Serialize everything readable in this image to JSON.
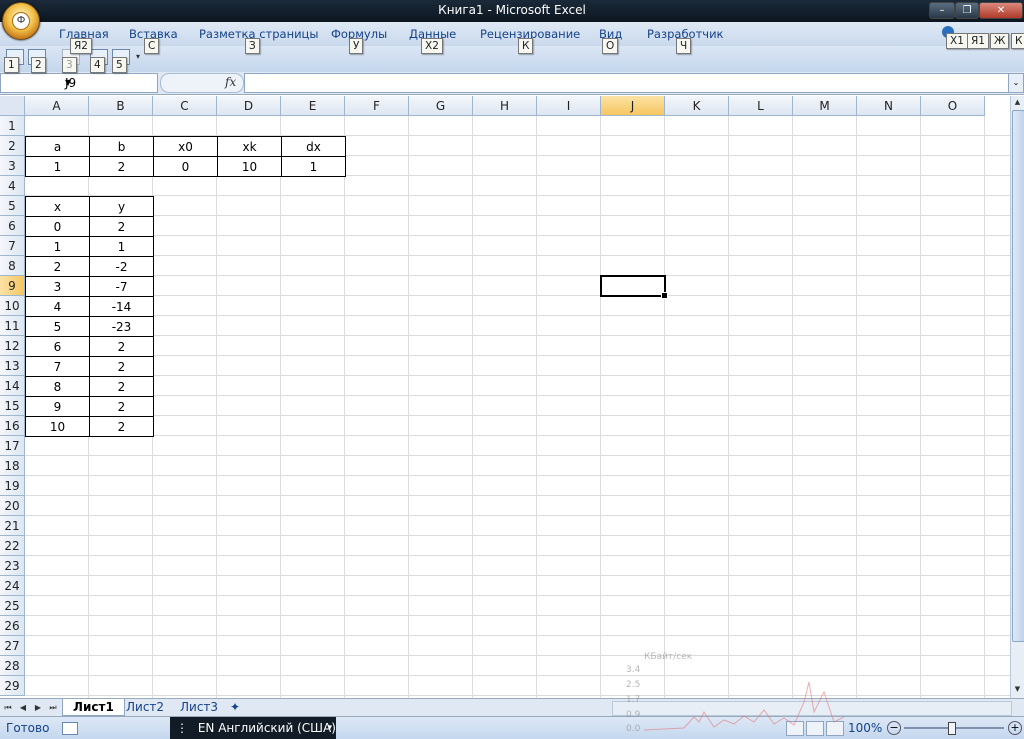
{
  "window": {
    "title": "Книга1 - Microsoft Excel",
    "controls": {
      "minimize": "–",
      "restore": "❐",
      "close": "✕"
    }
  },
  "office_button": {
    "keytip": "Ф"
  },
  "ribbon_tabs": [
    {
      "label": "Главная",
      "keytip": "Я2"
    },
    {
      "label": "Вставка",
      "keytip": "С"
    },
    {
      "label": "Разметка страницы",
      "keytip": "З"
    },
    {
      "label": "Формулы",
      "keytip": "У"
    },
    {
      "label": "Данные",
      "keytip": "Х2"
    },
    {
      "label": "Рецензирование",
      "keytip": "К"
    },
    {
      "label": "Вид",
      "keytip": "О"
    },
    {
      "label": "Разработчик",
      "keytip": "Ч"
    }
  ],
  "right_keytips": [
    "Х1",
    "Я1",
    "Ж",
    "К"
  ],
  "qat_keytips": [
    "1",
    "2",
    "3",
    "4",
    "5"
  ],
  "formula_bar": {
    "name_box": "J9",
    "fx_label": "fx",
    "formula": ""
  },
  "columns": [
    "A",
    "B",
    "C",
    "D",
    "E",
    "F",
    "G",
    "H",
    "I",
    "J",
    "K",
    "L",
    "M",
    "N",
    "O"
  ],
  "rows": [
    "1",
    "2",
    "3",
    "4",
    "5",
    "6",
    "7",
    "8",
    "9",
    "10",
    "11",
    "12",
    "13",
    "14",
    "15",
    "16",
    "17",
    "18",
    "19",
    "20",
    "21",
    "22",
    "23",
    "24",
    "25",
    "26",
    "27",
    "28",
    "29"
  ],
  "selected_cell": {
    "column": "J",
    "row": "9"
  },
  "params_table": {
    "headers": [
      "a",
      "b",
      "x0",
      "xk",
      "dx"
    ],
    "values": [
      "1",
      "2",
      "0",
      "10",
      "1"
    ]
  },
  "xy_table": {
    "headers": [
      "x",
      "y"
    ],
    "rows": [
      [
        "0",
        "2"
      ],
      [
        "1",
        "1"
      ],
      [
        "2",
        "-2"
      ],
      [
        "3",
        "-7"
      ],
      [
        "4",
        "-14"
      ],
      [
        "5",
        "-23"
      ],
      [
        "6",
        "2"
      ],
      [
        "7",
        "2"
      ],
      [
        "8",
        "2"
      ],
      [
        "9",
        "2"
      ],
      [
        "10",
        "2"
      ]
    ]
  },
  "sheet_tabs": [
    {
      "label": "Лист1",
      "active": true
    },
    {
      "label": "Лист2",
      "active": false
    },
    {
      "label": "Лист3",
      "active": false
    }
  ],
  "status": {
    "ready": "Готово",
    "language": "EN Английский (США)",
    "zoom": "100%"
  },
  "network_overlay": {
    "unit": "КБайт/сек",
    "ticks": [
      "3.4",
      "2.5",
      "1.7",
      "0.9",
      "0.0"
    ]
  }
}
